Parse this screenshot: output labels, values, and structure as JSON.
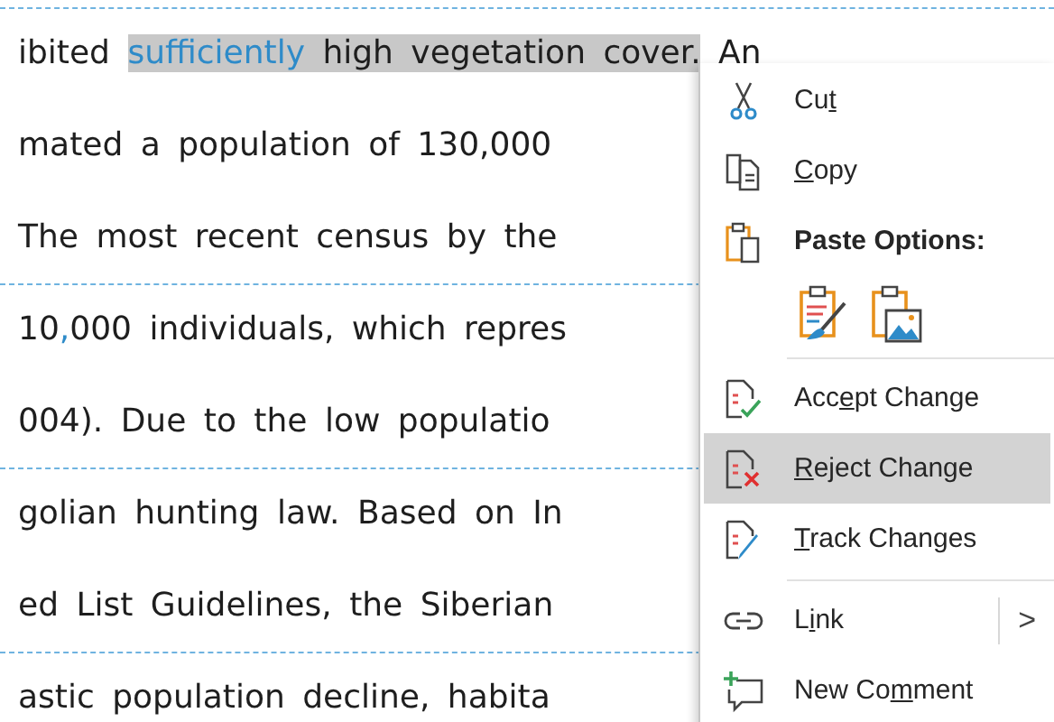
{
  "document": {
    "lines": [
      {
        "revision_border": true,
        "segments": [
          {
            "text": "ibited ",
            "inserted": false,
            "selected": false
          },
          {
            "text": "sufficiently",
            "inserted": true,
            "selected": true
          },
          {
            "text": " high vegetation cover.",
            "inserted": false,
            "selected": true
          },
          {
            "text": " An",
            "inserted": false,
            "selected": false
          }
        ]
      },
      {
        "revision_border": false,
        "segments": [
          {
            "text": "mated a population of 130,000",
            "inserted": false,
            "selected": false
          }
        ]
      },
      {
        "revision_border": false,
        "segments": [
          {
            "text": "The most recent census by the",
            "inserted": false,
            "selected": false
          }
        ]
      },
      {
        "revision_border": true,
        "segments": [
          {
            "text": "10",
            "inserted": false,
            "selected": false
          },
          {
            "text": ",",
            "inserted": true,
            "selected": false
          },
          {
            "text": "000 individuals, which repres",
            "inserted": false,
            "selected": false
          }
        ]
      },
      {
        "revision_border": false,
        "segments": [
          {
            "text": "004). Due to the low populatio",
            "inserted": false,
            "selected": false
          }
        ]
      },
      {
        "revision_border": true,
        "segments": [
          {
            "text": "golian hunting law. Based on In",
            "inserted": false,
            "selected": false
          }
        ]
      },
      {
        "revision_border": false,
        "segments": [
          {
            "text": "ed List Guidelines, the Siberian",
            "inserted": false,
            "selected": false
          }
        ]
      },
      {
        "revision_border": true,
        "segments": [
          {
            "text": "astic population decline, habita",
            "inserted": false,
            "selected": false
          }
        ]
      }
    ]
  },
  "context_menu": {
    "items": [
      {
        "kind": "command",
        "label": [
          {
            "text": "Cu",
            "underlined": false
          },
          {
            "text": "t",
            "underlined": true
          }
        ],
        "selected": false
      },
      {
        "kind": "command",
        "label": [
          {
            "text": "C",
            "underlined": true
          },
          {
            "text": "opy",
            "underlined": false
          }
        ],
        "selected": false
      },
      {
        "kind": "heading",
        "label": [
          {
            "text": "Paste Options:",
            "underlined": false
          }
        ]
      },
      {
        "kind": "paste_row"
      },
      {
        "kind": "separator"
      },
      {
        "kind": "command",
        "label": [
          {
            "text": "Acc",
            "underlined": false
          },
          {
            "text": "e",
            "underlined": true
          },
          {
            "text": "pt Change",
            "underlined": false
          }
        ],
        "selected": false
      },
      {
        "kind": "command",
        "label": [
          {
            "text": "R",
            "underlined": true
          },
          {
            "text": "eject Change",
            "underlined": false
          }
        ],
        "selected": true
      },
      {
        "kind": "command",
        "label": [
          {
            "text": "T",
            "underlined": true
          },
          {
            "text": "rack Changes",
            "underlined": false
          }
        ],
        "selected": false
      },
      {
        "kind": "separator"
      },
      {
        "kind": "submenu",
        "label": [
          {
            "text": "L",
            "underlined": false
          },
          {
            "text": "i",
            "underlined": true
          },
          {
            "text": "nk",
            "underlined": false
          }
        ],
        "selected": false,
        "arrow": ">"
      },
      {
        "kind": "command",
        "label": [
          {
            "text": "New Co",
            "underlined": false
          },
          {
            "text": "m",
            "underlined": true
          },
          {
            "text": "ment",
            "underlined": false
          }
        ],
        "selected": false
      }
    ]
  }
}
